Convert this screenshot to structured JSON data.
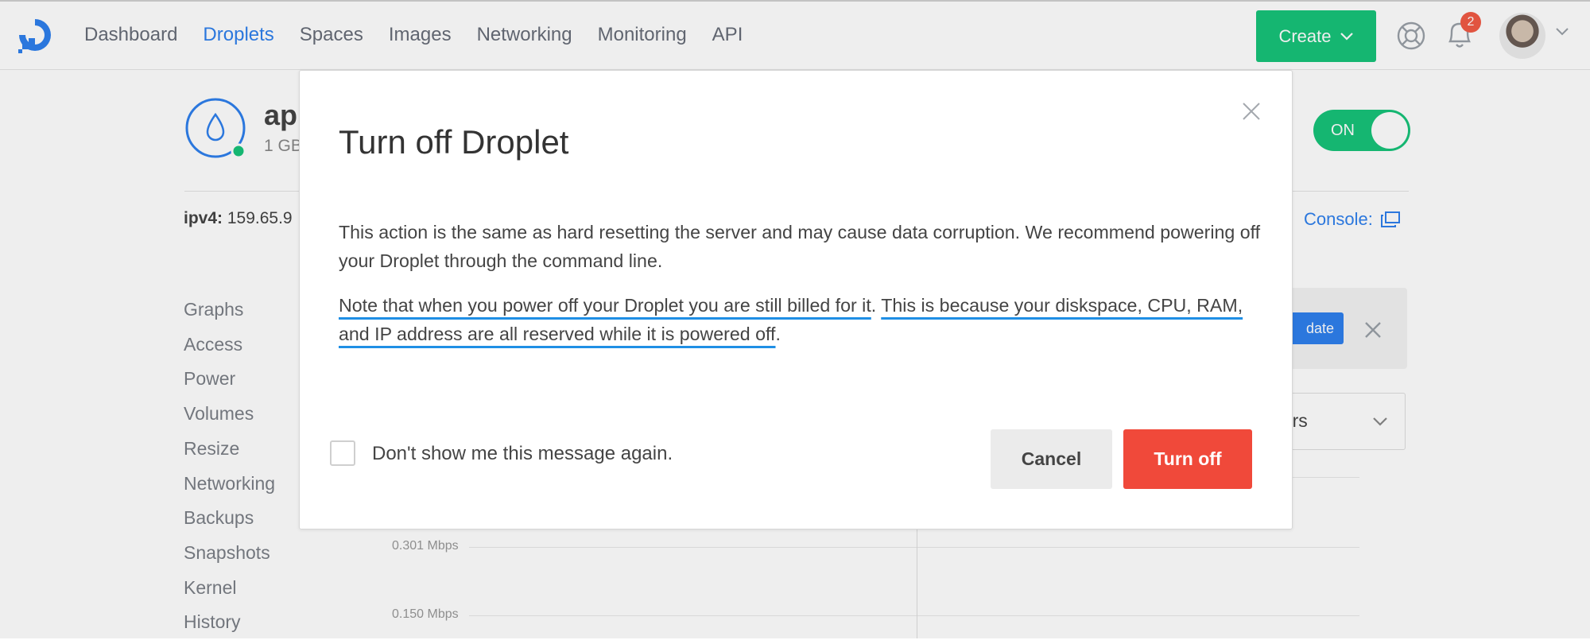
{
  "nav": {
    "items": [
      "Dashboard",
      "Droplets",
      "Spaces",
      "Images",
      "Networking",
      "Monitoring",
      "API"
    ],
    "active": "Droplets",
    "create_label": "Create",
    "notifications_count": "2"
  },
  "droplet": {
    "name": "ap",
    "subtitle": "1 GB",
    "power_toggle": "ON",
    "ipv4_label": "ipv4:",
    "ipv4_value": "159.65.9",
    "console_label": "Console:"
  },
  "sidenav": {
    "items": [
      "Graphs",
      "Access",
      "Power",
      "Volumes",
      "Resize",
      "Networking",
      "Backups",
      "Snapshots",
      "Kernel",
      "History"
    ]
  },
  "background": {
    "update_label": "date",
    "period_label": "ours",
    "grid_labels": [
      "0.301 Mbps",
      "0.150 Mbps"
    ]
  },
  "modal": {
    "title": "Turn off Droplet",
    "paragraph1": "This action is the same as hard resetting the server and may cause data corruption. We recommend powering off your Droplet through the command line.",
    "paragraph2_part1": "Note that when you power off your Droplet you are still billed for it",
    "paragraph2_sep": ". ",
    "paragraph2_part2": "This is because your diskspace, CPU, RAM, and IP address are all reserved while it is powered off",
    "paragraph2_end": ".",
    "checkbox_label": "Don't show me this message again.",
    "checkbox_checked": false,
    "cancel_label": "Cancel",
    "confirm_label": "Turn off"
  },
  "colors": {
    "brand_blue": "#2f80ed",
    "create_green": "#17c37a",
    "danger_red": "#f0493a",
    "annotation_underline": "#1f8fe5"
  }
}
